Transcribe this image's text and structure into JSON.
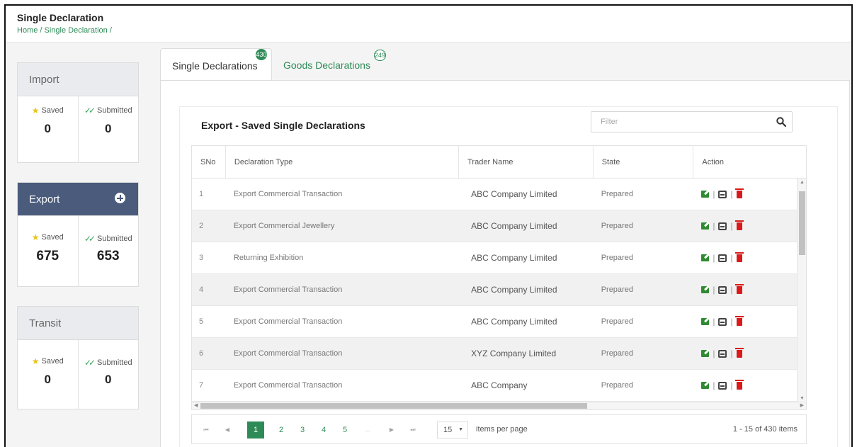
{
  "header": {
    "title": "Single Declaration",
    "breadcrumb": "Home / Single Declaration /"
  },
  "sidebar": {
    "import": {
      "title": "Import",
      "saved_label": "Saved",
      "submitted_label": "Submitted",
      "saved_count": "0",
      "submitted_count": "0"
    },
    "export": {
      "title": "Export",
      "saved_label": "Saved",
      "submitted_label": "Submitted",
      "saved_count": "675",
      "submitted_count": "653"
    },
    "transit": {
      "title": "Transit",
      "saved_label": "Saved",
      "submitted_label": "Submitted",
      "saved_count": "0",
      "submitted_count": "0"
    }
  },
  "tabs": [
    {
      "label": "Single Declarations",
      "badge": "430",
      "active": true
    },
    {
      "label": "Goods Declarations",
      "badge": "249",
      "active": false
    }
  ],
  "section": {
    "title": "Export - Saved Single Declarations",
    "filter_placeholder": "Filter"
  },
  "table": {
    "headers": [
      "SNo",
      "Declaration Type",
      "Trader Name",
      "State",
      "Action"
    ],
    "rows": [
      {
        "sno": "1",
        "type": "Export Commercial Transaction",
        "trader": "ABC Company Limited",
        "state": "Prepared"
      },
      {
        "sno": "2",
        "type": "Export Commercial Jewellery",
        "trader": "ABC Company Limited",
        "state": "Prepared"
      },
      {
        "sno": "3",
        "type": "Returning Exhibition",
        "trader": "ABC Company Limited",
        "state": "Prepared"
      },
      {
        "sno": "4",
        "type": "Export Commercial Transaction",
        "trader": "ABC Company Limited",
        "state": "Prepared"
      },
      {
        "sno": "5",
        "type": "Export Commercial Transaction",
        "trader": "ABC Company Limited",
        "state": "Prepared"
      },
      {
        "sno": "6",
        "type": "Export Commercial Transaction",
        "trader": "XYZ Company Limited",
        "state": "Prepared"
      },
      {
        "sno": "7",
        "type": "Export Commercial Transaction",
        "trader": "ABC Company",
        "state": "Prepared"
      }
    ],
    "action_separator": "|"
  },
  "pager": {
    "pages": [
      "1",
      "2",
      "3",
      "4",
      "5",
      "..."
    ],
    "active_page": "1",
    "page_size": "15",
    "items_per_page_label": "items per page",
    "range_text": "1 - 15 of 430 items"
  },
  "colors": {
    "accent": "#2e8b57",
    "export_header": "#4a5b7c",
    "delete": "#d91a1a"
  }
}
